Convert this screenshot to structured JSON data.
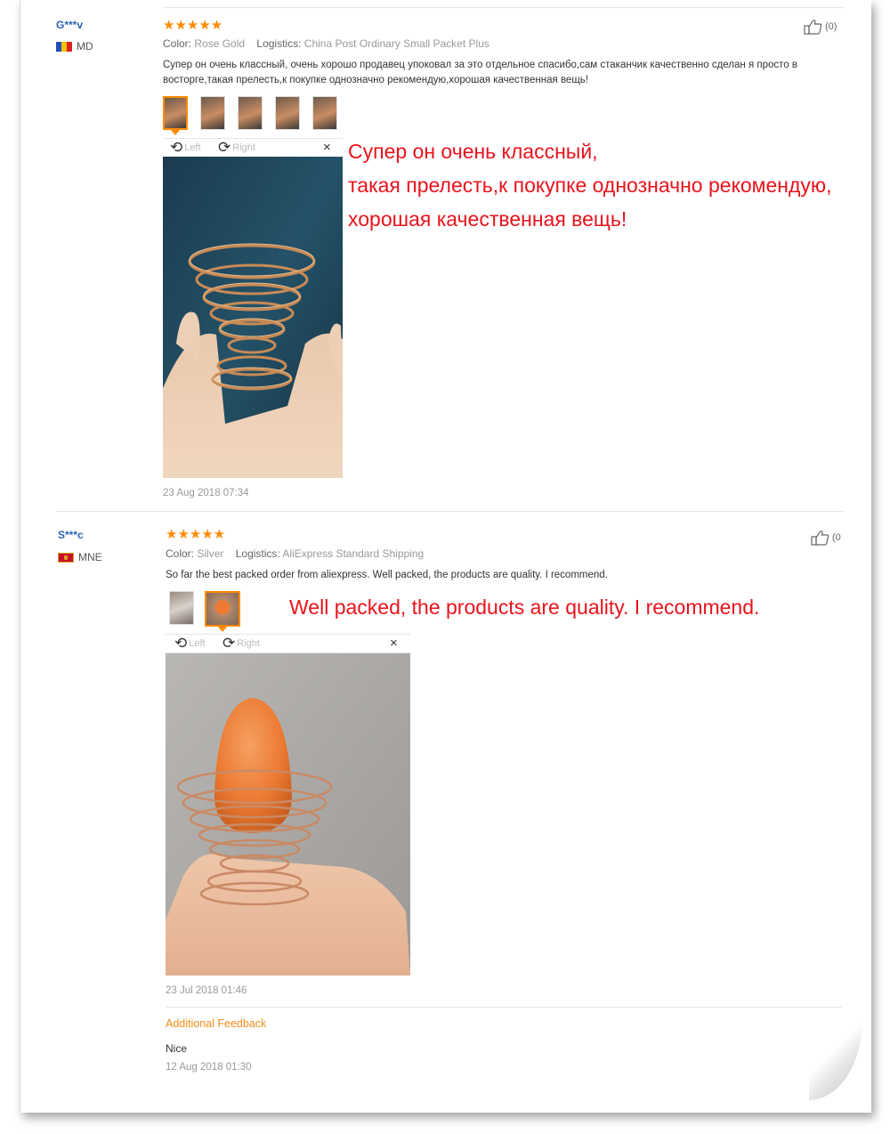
{
  "reviews": [
    {
      "user": "G***v",
      "country": "MD",
      "stars": "★★★★★",
      "color_label": "Color:",
      "color_value": "Rose Gold",
      "logistics_label": "Logistics:",
      "logistics_value": "China Post Ordinary Small Packet Plus",
      "text": "Супер он очень классный, очень хорошо продавец упоковал за это отдельное спасибо,сам стаканчик качественно сделан я просто в восторге,такая прелесть,к покупке однозначно рекомендую,хорошая качественная вещь!",
      "helpful": "(0)",
      "viewer": {
        "left": "Left",
        "right": "Right",
        "close": "×"
      },
      "date": "23 Aug 2018 07:34",
      "overlay": [
        "Супер он очень классный,",
        "такая прелесть,к покупке однозначно рекомендую,",
        "хорошая качественная вещь!"
      ],
      "photo_count": 5,
      "selected_photo": 1
    },
    {
      "user": "S***c",
      "country": "MNE",
      "stars": "★★★★★",
      "color_label": "Color:",
      "color_value": "Silver",
      "logistics_label": "Logistics:",
      "logistics_value": "AliExpress Standard Shipping",
      "text": "So far the best packed order from aliexpress. Well packed, the products are quality. I recommend.",
      "helpful": "(0",
      "viewer": {
        "left": "Left",
        "right": "Right",
        "close": "×"
      },
      "date": "23 Jul 2018 01:46",
      "overlay": [
        "Well packed, the products are quality. I recommend."
      ],
      "photo_count": 2,
      "selected_photo": 2,
      "additional": {
        "title": "Additional Feedback",
        "text": "Nice",
        "date": "12 Aug 2018 01:30"
      }
    }
  ],
  "icons": {
    "thumbs_up": "thumbs-up-icon",
    "rotate_left": "rotate-left-icon",
    "rotate_right": "rotate-right-icon",
    "close": "close-icon"
  },
  "colors": {
    "accent": "#ff8a00",
    "username": "#2b63b5",
    "overlay_text": "#e8131c",
    "additional_title": "#f08c1a"
  }
}
